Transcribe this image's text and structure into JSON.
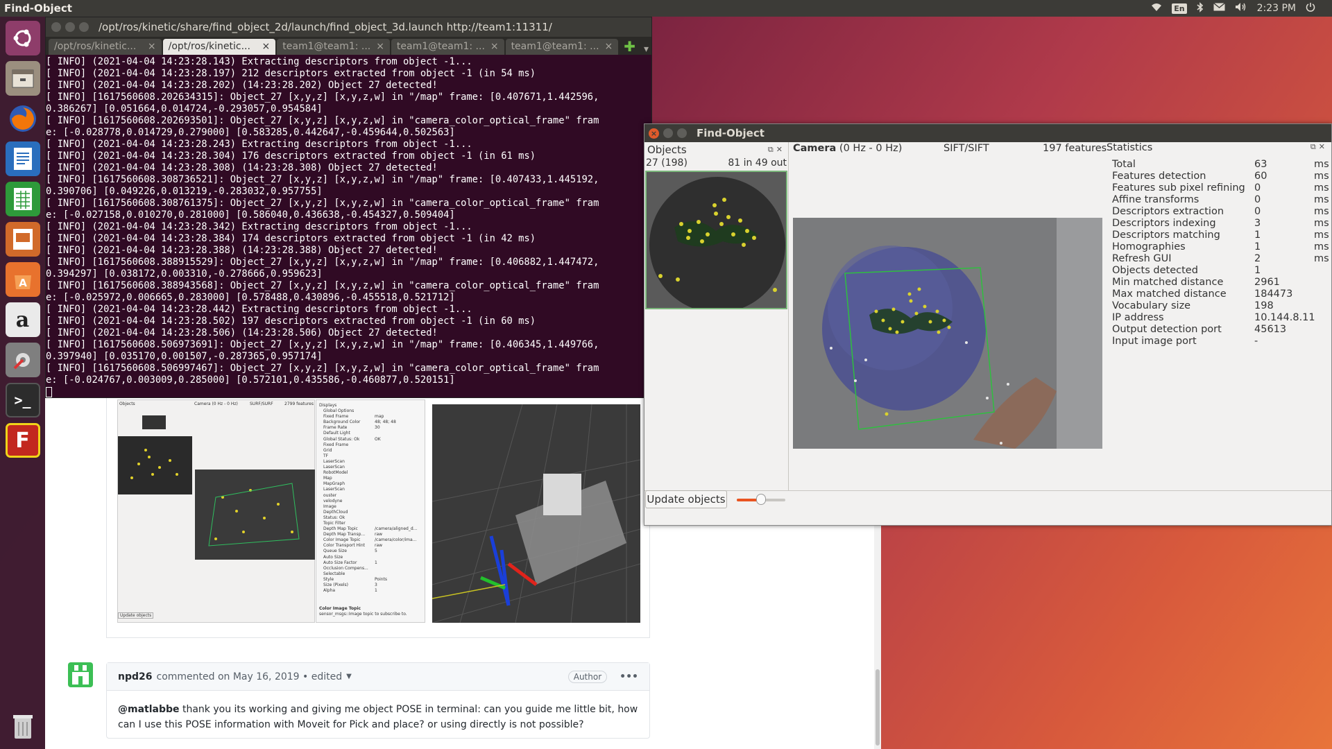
{
  "top_panel": {
    "app_title": "Find-Object",
    "lang": "En",
    "clock": "2:23 PM"
  },
  "launcher": {
    "items": [
      "ubuntu-icon",
      "files-icon",
      "firefox-icon",
      "writer-icon",
      "calc-icon",
      "impress-icon",
      "software-center-icon",
      "amazon-icon",
      "settings-icon",
      "terminal-icon",
      "find-object-icon",
      "trash-icon"
    ]
  },
  "terminal": {
    "title": "/opt/ros/kinetic/share/find_object_2d/launch/find_object_3d.launch http://team1:11311/",
    "tabs": [
      {
        "label": "/opt/ros/kinetic..."
      },
      {
        "label": "/opt/ros/kinetic..."
      },
      {
        "label": "team1@team1: ..."
      },
      {
        "label": "team1@team1: ..."
      },
      {
        "label": "team1@team1: ..."
      }
    ],
    "lines": [
      "[ INFO] (2021-04-04 14:23:28.143) Extracting descriptors from object -1...",
      "[ INFO] (2021-04-04 14:23:28.197) 212 descriptors extracted from object -1 (in 54 ms)",
      "[ INFO] (2021-04-04 14:23:28.202) (14:23:28.202) Object 27 detected!",
      "[ INFO] [1617560608.202634315]: Object_27 [x,y,z] [x,y,z,w] in \"/map\" frame: [0.407671,1.442596,",
      "0.386267] [0.051664,0.014724,-0.293057,0.954584]",
      "[ INFO] [1617560608.202693501]: Object_27 [x,y,z] [x,y,z,w] in \"camera_color_optical_frame\" fram",
      "e: [-0.028778,0.014729,0.279000] [0.583285,0.442647,-0.459644,0.502563]",
      "[ INFO] (2021-04-04 14:23:28.243) Extracting descriptors from object -1...",
      "[ INFO] (2021-04-04 14:23:28.304) 176 descriptors extracted from object -1 (in 61 ms)",
      "[ INFO] (2021-04-04 14:23:28.308) (14:23:28.308) Object 27 detected!",
      "[ INFO] [1617560608.308736521]: Object_27 [x,y,z] [x,y,z,w] in \"/map\" frame: [0.407433,1.445192,",
      "0.390706] [0.049226,0.013219,-0.283032,0.957755]",
      "[ INFO] [1617560608.308761375]: Object_27 [x,y,z] [x,y,z,w] in \"camera_color_optical_frame\" fram",
      "e: [-0.027158,0.010270,0.281000] [0.586040,0.436638,-0.454327,0.509404]",
      "[ INFO] (2021-04-04 14:23:28.342) Extracting descriptors from object -1...",
      "[ INFO] (2021-04-04 14:23:28.384) 174 descriptors extracted from object -1 (in 42 ms)",
      "[ INFO] (2021-04-04 14:23:28.388) (14:23:28.388) Object 27 detected!",
      "[ INFO] [1617560608.388915529]: Object_27 [x,y,z] [x,y,z,w] in \"/map\" frame: [0.406882,1.447472,",
      "0.394297] [0.038172,0.003310,-0.278666,0.959623]",
      "[ INFO] [1617560608.388943568]: Object_27 [x,y,z] [x,y,z,w] in \"camera_color_optical_frame\" fram",
      "e: [-0.025972,0.006665,0.283000] [0.578488,0.430896,-0.455518,0.521712]",
      "[ INFO] (2021-04-04 14:23:28.442) Extracting descriptors from object -1...",
      "[ INFO] (2021-04-04 14:23:28.502) 197 descriptors extracted from object -1 (in 60 ms)",
      "[ INFO] (2021-04-04 14:23:28.506) (14:23:28.506) Object 27 detected!",
      "[ INFO] [1617560608.506973691]: Object_27 [x,y,z] [x,y,z,w] in \"/map\" frame: [0.406345,1.449766,",
      "0.397940] [0.035170,0.001507,-0.287365,0.957174]",
      "[ INFO] [1617560608.506997467]: Object_27 [x,y,z] [x,y,z,w] in \"camera_color_optical_frame\" fram",
      "e: [-0.024767,0.003009,0.285000] [0.572101,0.435586,-0.460877,0.520151]"
    ]
  },
  "find_object": {
    "window_title": "Find-Object",
    "objects_panel": {
      "title": "Objects",
      "object_id": "27 (198)",
      "match_info": "81 in 49 out"
    },
    "camera_panel": {
      "title": "Camera",
      "rate": "(0 Hz - 0 Hz)",
      "algorithm": "SIFT/SIFT",
      "features": "197 features"
    },
    "update_button": "Update objects",
    "slider_value": 0.5,
    "statistics": {
      "title": "Statistics",
      "rows": [
        {
          "label": "Total",
          "value": "63",
          "unit": "ms"
        },
        {
          "label": "Features detection",
          "value": "60",
          "unit": "ms"
        },
        {
          "label": "Features sub pixel refining",
          "value": "0",
          "unit": "ms"
        },
        {
          "label": "Affine transforms",
          "value": "0",
          "unit": "ms"
        },
        {
          "label": "Descriptors extraction",
          "value": "0",
          "unit": "ms"
        },
        {
          "label": "Descriptors indexing",
          "value": "3",
          "unit": "ms"
        },
        {
          "label": "Descriptors matching",
          "value": "1",
          "unit": "ms"
        },
        {
          "label": "Homographies",
          "value": "1",
          "unit": "ms"
        },
        {
          "label": "Refresh GUI",
          "value": "2",
          "unit": "ms"
        },
        {
          "label": "Objects detected",
          "value": "1",
          "unit": ""
        },
        {
          "label": "Min matched distance",
          "value": "2961",
          "unit": ""
        },
        {
          "label": "Max matched distance",
          "value": "184473",
          "unit": ""
        },
        {
          "label": "Vocabulary size",
          "value": "198",
          "unit": ""
        },
        {
          "label": "IP address",
          "value": "10.144.8.11",
          "unit": ""
        },
        {
          "label": "Output detection port",
          "value": "45613",
          "unit": ""
        },
        {
          "label": "Input image port",
          "value": "-",
          "unit": ""
        }
      ]
    }
  },
  "browser": {
    "comment": {
      "author": "npd26",
      "meta": "commented on May 16, 2019 • edited",
      "badge": "Author",
      "more": "•••",
      "mention": "@matlabbe",
      "body": " thank you its working and giving me object POSE in terminal: can you guide me little bit, how can I use this POSE information with Moveit for Pick and place? or using directly is not possible?"
    },
    "screenshot": {
      "fo_camera_label": "Camera (0 Hz - 0 Hz)",
      "fo_algo": "SURF/SURF",
      "fo_features": "2799 features",
      "fo_objects": "Objects",
      "fo_update": "Update objects",
      "rviz_items": [
        "Displays",
        "Global Options",
        "Fixed Frame",
        "Background Color",
        "Frame Rate",
        "Default Light",
        "Global Status: Ok",
        "Fixed Frame",
        "Grid",
        "TF",
        "LaserScan",
        "LaserScan",
        "RobotModel",
        "Map",
        "MapGraph",
        "LaserScan",
        "ouster",
        "velodyne",
        "Image",
        "DepthCloud",
        "Status: Ok",
        "Topic Filter",
        "Depth Map Topic",
        "Depth Map Transp...",
        "Color Image Topic",
        "Color Transport Hint",
        "Queue Size",
        "Auto Size",
        "Auto Size Factor",
        "Occlusion Compens...",
        "Selectable",
        "Style",
        "Size (Pixels)",
        "Alpha"
      ],
      "rviz_values": [
        "",
        "",
        "map",
        "48; 48; 48",
        "30",
        "",
        "OK",
        "",
        "",
        "",
        "",
        "",
        "",
        "",
        "",
        "",
        "",
        "",
        "",
        "",
        "",
        "",
        "/camera/aligned_d...",
        "raw",
        "/camera/color/ima...",
        "raw",
        "5",
        "",
        "1",
        "",
        "",
        "Points",
        "3",
        "1"
      ],
      "rviz_footer_title": "Color Image Topic",
      "rviz_footer_text": "sensor_msgs::Image topic to subscribe to."
    }
  }
}
